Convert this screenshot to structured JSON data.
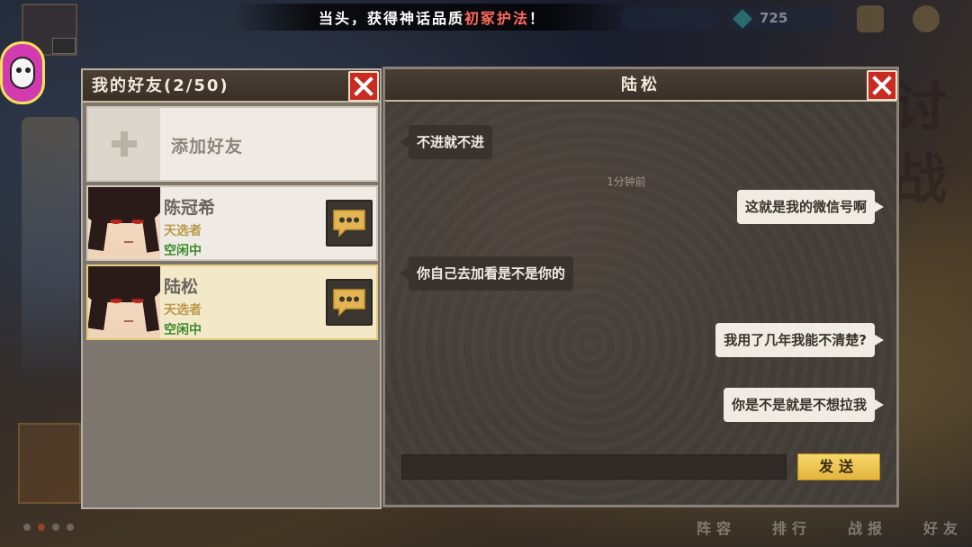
{
  "hud": {
    "announcement_prefix": "当头，获得神话品质",
    "announcement_highlight": "初冢护法",
    "announcement_suffix": "！",
    "gem_count": "725"
  },
  "background": {
    "right_glyphs": [
      "讨",
      "战"
    ],
    "bottom_nav": [
      "阵容",
      "排行",
      "战报",
      "好友"
    ]
  },
  "friends_panel": {
    "title": "我的好友(2/50)",
    "add_friend_label": "添加好友",
    "friends": [
      {
        "name": "陈冠希",
        "title": "天选者",
        "status": "空闲中",
        "selected": false
      },
      {
        "name": "陆松",
        "title": "天选者",
        "status": "空闲中",
        "selected": true
      }
    ]
  },
  "chat_panel": {
    "title": "陆松",
    "messages": [
      {
        "side": "left",
        "text": "不进就不进"
      },
      {
        "side": "time",
        "text": "1分钟前"
      },
      {
        "side": "right",
        "text": "这就是我的微信号啊"
      },
      {
        "side": "left",
        "text": "你自己去加看是不是你的"
      },
      {
        "side": "right",
        "text": "我用了几年我能不清楚?"
      },
      {
        "side": "right",
        "text": "你是不是就是不想拉我"
      }
    ],
    "input_value": "",
    "input_placeholder": "",
    "send_label": "发送"
  },
  "colors": {
    "accent_close": "#c72b22",
    "send_button": "#e3b43c",
    "status_green": "#3e8a2e",
    "title_gold": "#b89a4a",
    "highlight_red": "#ff6a5a"
  }
}
